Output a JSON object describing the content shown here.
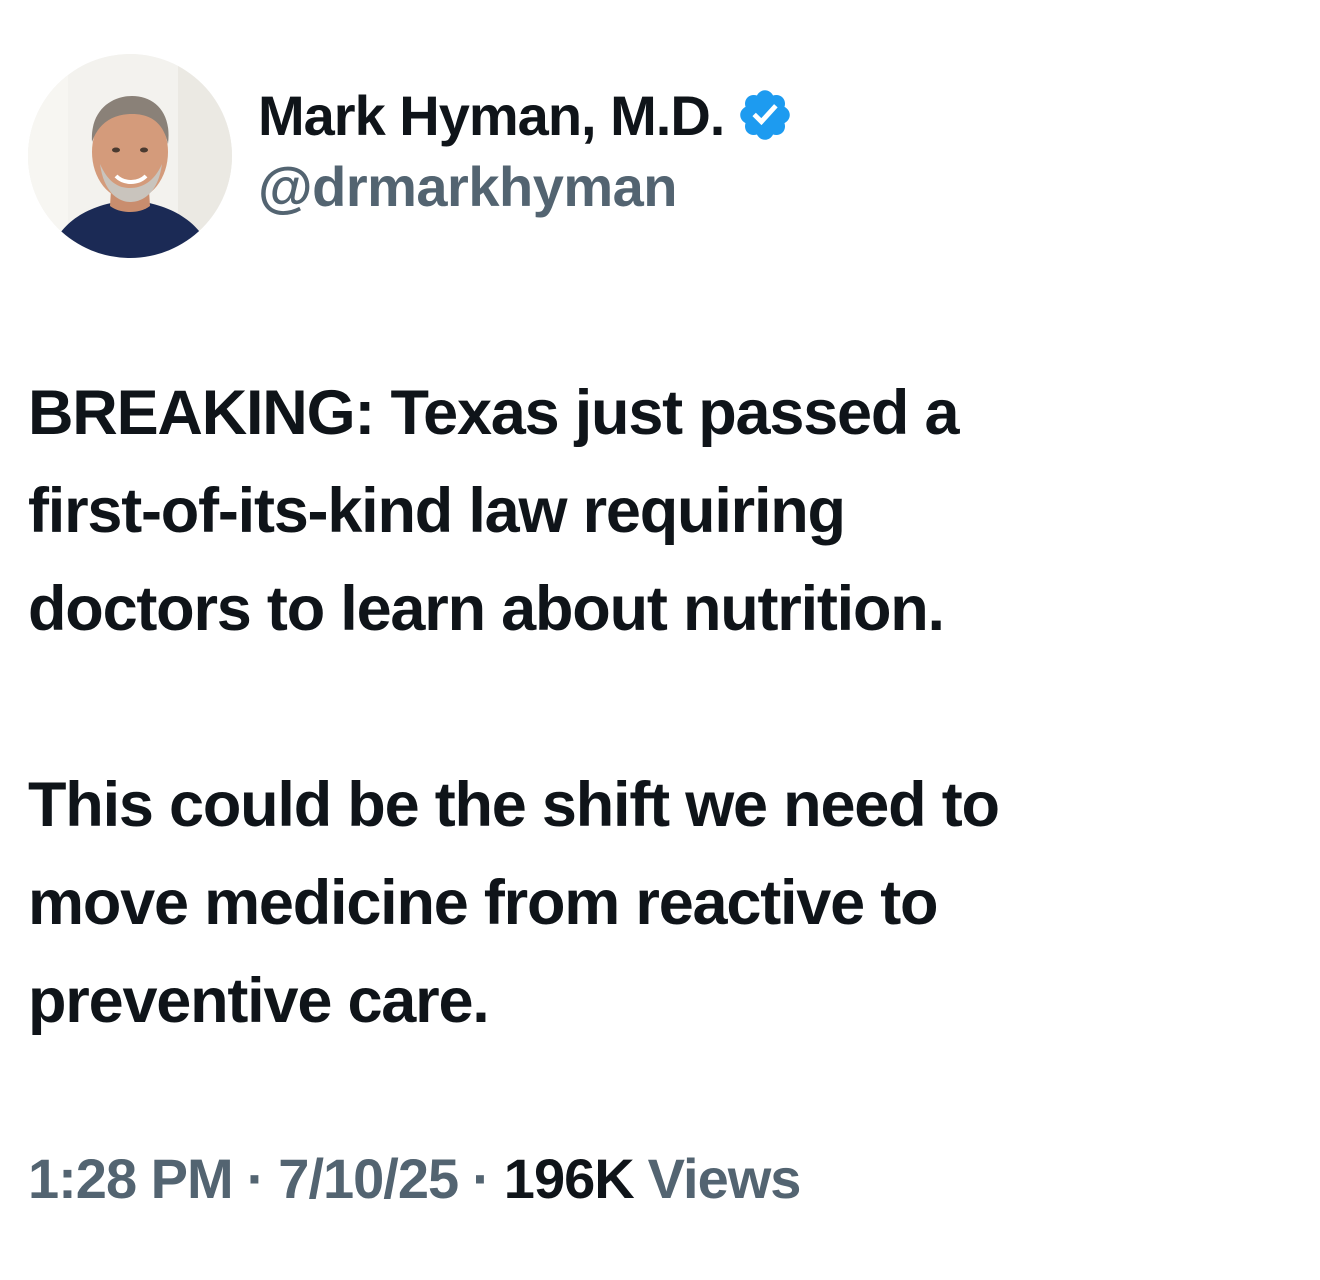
{
  "author": {
    "display_name": "Mark Hyman, M.D.",
    "handle": "@drmarkhyman",
    "verified": true,
    "verified_color": "#1d9bf0"
  },
  "tweet": {
    "paragraphs": [
      [
        "BREAKING: Texas just passed a",
        "first-of-its-kind law requiring",
        "doctors to learn about nutrition."
      ],
      [
        "This could be the shift we need to",
        "move medicine from reactive to",
        "preventive care."
      ]
    ]
  },
  "meta": {
    "time": "1:28 PM",
    "separator": "·",
    "date": "7/10/25",
    "views_count": "196K",
    "views_label": "Views"
  },
  "colors": {
    "text_primary": "#0f1419",
    "text_secondary": "#536471"
  }
}
